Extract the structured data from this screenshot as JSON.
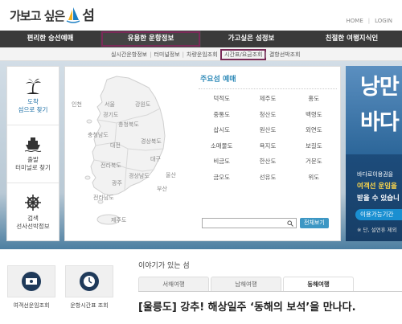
{
  "header": {
    "logo_part1": "가보고 싶은",
    "logo_part2": "섬",
    "util_links": [
      "HOME",
      "LOGIN"
    ]
  },
  "gnb": {
    "items": [
      "편리한 승선예매",
      "유용한 운항정보",
      "가고싶은 섬정보",
      "친절한 여행지식인"
    ],
    "active_index": 1
  },
  "subnav": {
    "items": [
      "실시간운항정보",
      "터미널정보",
      "차량운임조회",
      "시간표/요금조회",
      "결항선박조회"
    ],
    "highlight_index": 3
  },
  "left_menu": [
    {
      "label": "도착\n섬으로 찾기",
      "icon": "palm-island-icon",
      "active": true
    },
    {
      "label": "출발\n터미널로 찾기",
      "icon": "ferry-icon",
      "active": false
    },
    {
      "label": "검색\n선사선박정보",
      "icon": "ship-wheel-icon",
      "active": false
    }
  ],
  "map": {
    "regions": [
      "인천",
      "서울",
      "강원도",
      "경기도",
      "충청북도",
      "충청남도",
      "대전",
      "경상북도",
      "대구",
      "전라북도",
      "광주",
      "경상남도",
      "울산",
      "부산",
      "전라남도",
      "제주도"
    ]
  },
  "islands": {
    "title": "주요섬 예매",
    "list": [
      "덕적도",
      "제주도",
      "홍도",
      "중통도",
      "청산도",
      "백령도",
      "삽시도",
      "원산도",
      "외연도",
      "소매물도",
      "욕지도",
      "보길도",
      "비금도",
      "한산도",
      "거문도",
      "금오도",
      "선유도",
      "위도"
    ]
  },
  "search": {
    "placeholder": "",
    "button_label": "전체보기"
  },
  "banner": {
    "big_line1": "낭만",
    "big_line2": "바다",
    "line1": "바다로이용권을",
    "line2": "여객선 운임을",
    "line3": "받을 수 있습니",
    "button_label": "이용가능기간",
    "note": "※ 단, 설연휴 제외"
  },
  "quick_links": [
    {
      "label": "여객선운임조회",
      "icon": "money-icon"
    },
    {
      "label": "운항시간표 조회",
      "icon": "clock-icon"
    }
  ],
  "story": {
    "title": "이야기가 있는 섬",
    "tabs": [
      "서해여행",
      "남해여행",
      "동해여행"
    ],
    "active_tab": 2,
    "headline": "[울릉도] 강추! 해상일주 ‘동해의 보석’을 만나다."
  },
  "colors": {
    "gnb_bg": "#3a3a3a",
    "highlight_outline": "#7a2a58",
    "accent_blue": "#2f8ab8",
    "button_blue": "#3d97c4"
  }
}
